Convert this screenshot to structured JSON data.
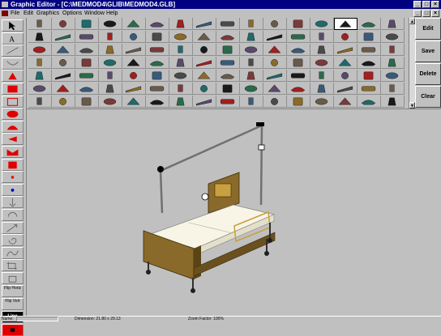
{
  "window": {
    "title": "Graphic Editor - [C:\\MEDMOD4\\GLIB\\MEDMOD4.GLB]",
    "controls": [
      "_",
      "□",
      "×"
    ]
  },
  "menu": [
    "File",
    "Edit",
    "Graphics",
    "Options",
    "Window",
    "Help"
  ],
  "actions": [
    "Edit",
    "Save",
    "Delete",
    "Clear"
  ],
  "tools_text": [
    "Flip Horiz",
    "Flip Vert",
    "Line"
  ],
  "status": {
    "name_label": "Name:",
    "dimension": "Dimension: 21.80 x 29.13",
    "zoom": "Zoom Factor: 100%"
  },
  "colors": {
    "title_bar": "#000080",
    "tool_red": "#e00000",
    "tool_blue": "#0000c0",
    "bed_frame": "#8a6a2a",
    "mattress": "#f8f4e6"
  }
}
